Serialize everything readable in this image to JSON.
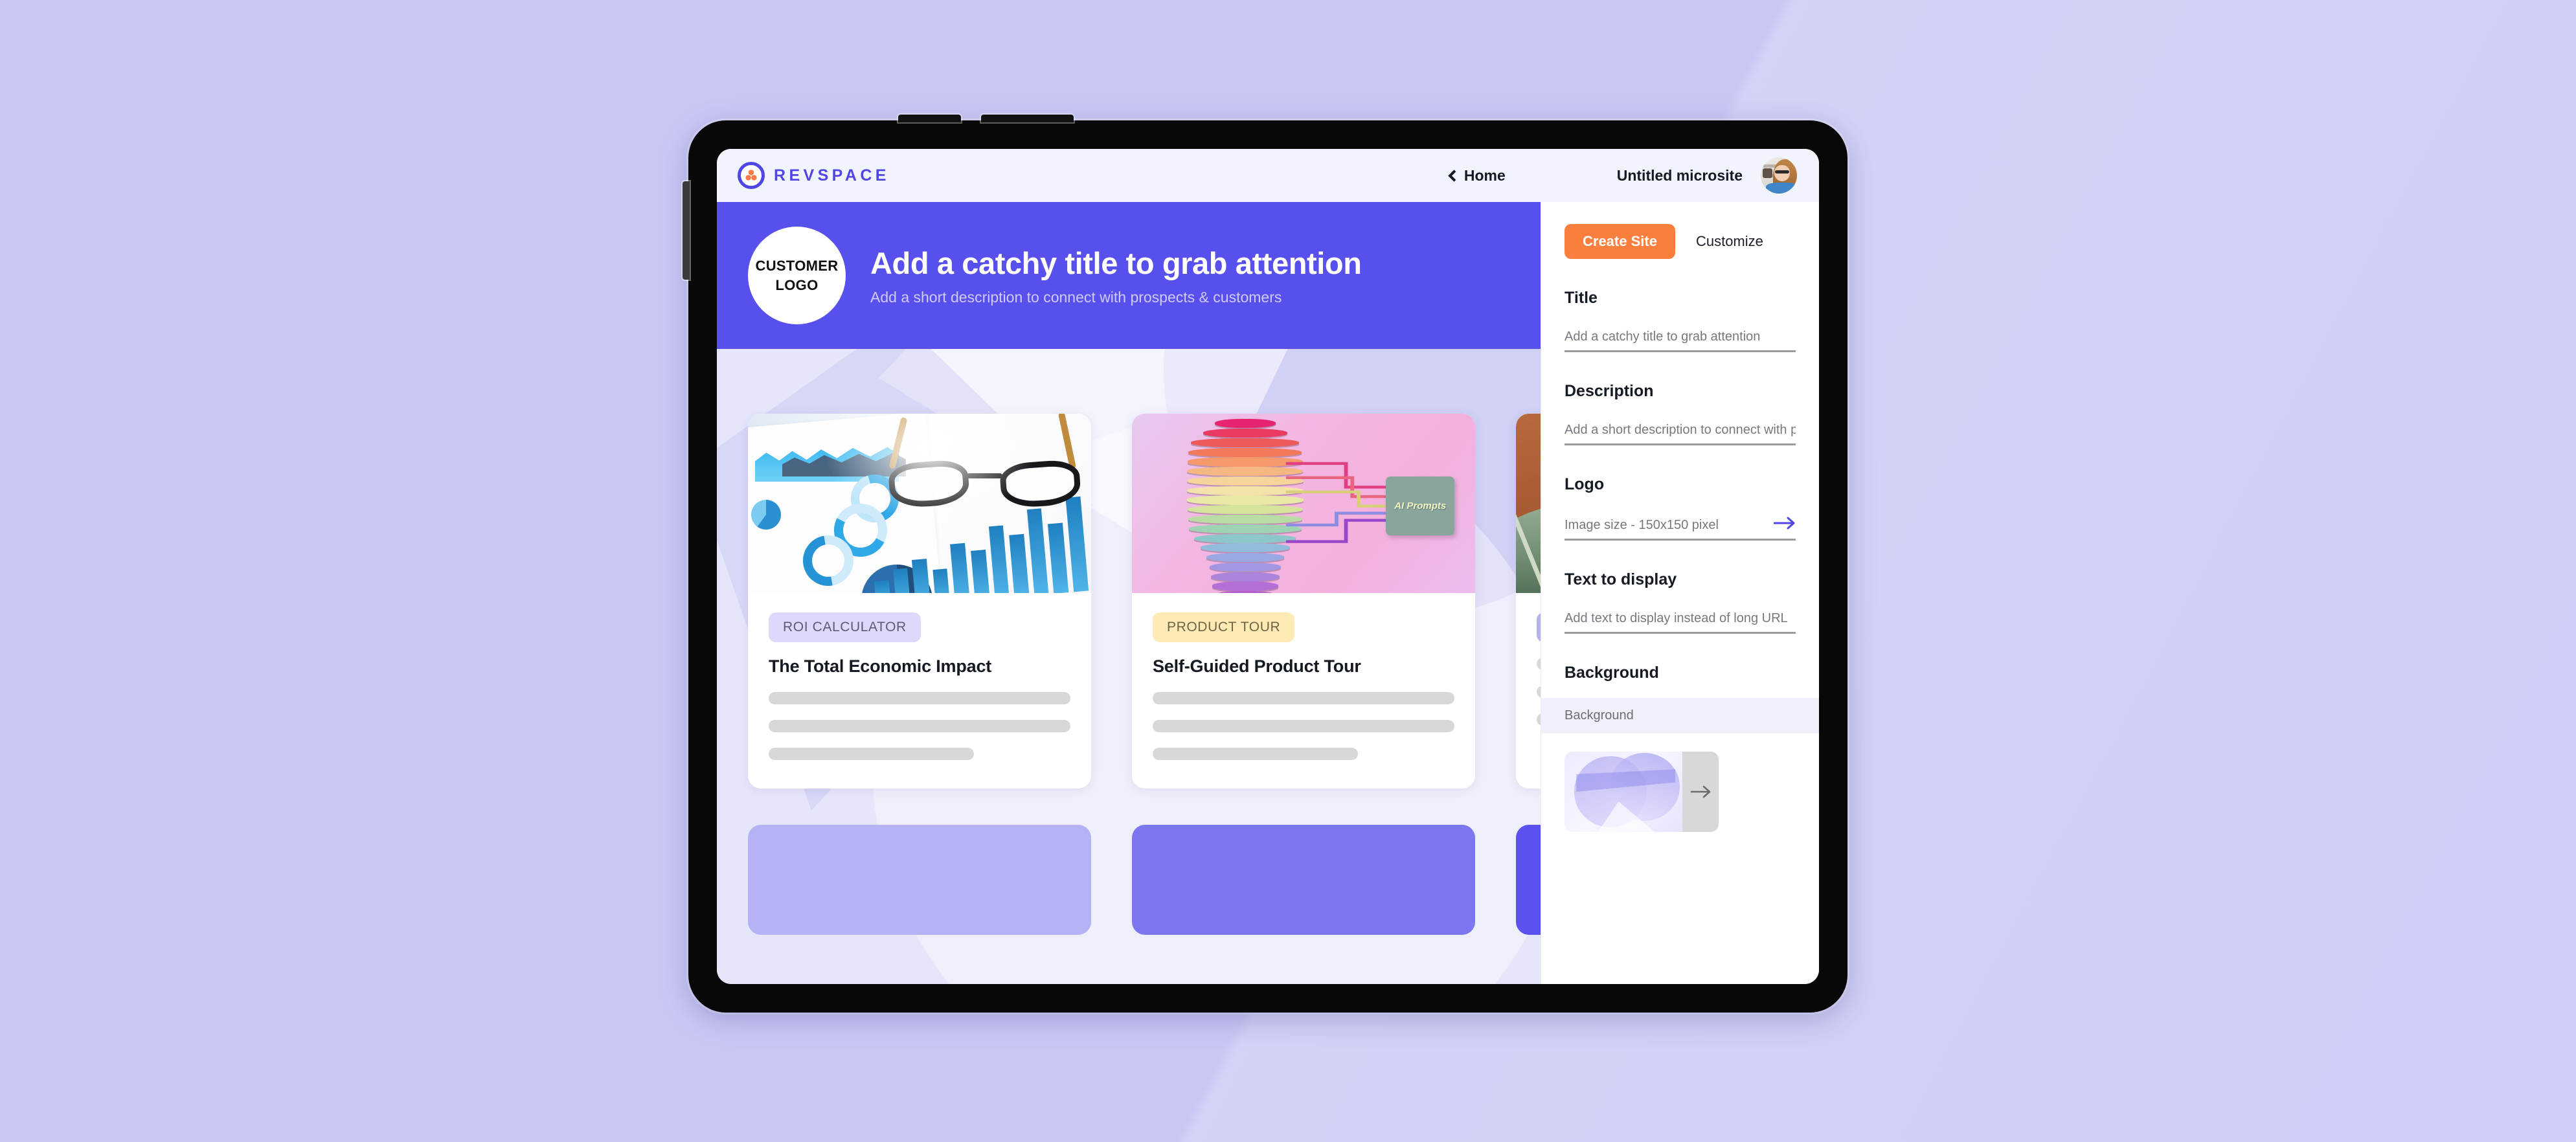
{
  "app": {
    "brand_name": "REVSPACE",
    "brand_icon": "revspace-logo-icon"
  },
  "topbar": {
    "home_label": "Home",
    "back_icon": "chevron-left-icon",
    "site_title": "Untitled microsite",
    "avatar_alt": "user-avatar"
  },
  "hero": {
    "logo_line1": "CUSTOMER",
    "logo_line2": "LOGO",
    "title": "Add a catchy title to grab attention",
    "subtitle": "Add a short description to connect with prospects & customers",
    "background_color": "#5850ec"
  },
  "cards": [
    {
      "badge": "ROI CALCULATOR",
      "badge_style": "badge-roi",
      "title": "The Total Economic Impact",
      "image": "charts-and-glasses-photo"
    },
    {
      "badge": "PRODUCT TOUR",
      "badge_style": "badge-tour",
      "title": "Self-Guided Product Tour",
      "image": "ai-prompts-head-illustration",
      "image_label": "AI Prompts"
    },
    {
      "badge": "",
      "badge_style": "badge-purple",
      "title": "",
      "image": "plant-and-bottle-photo"
    }
  ],
  "bottom_cards": [
    {
      "color": "#b5b2f6"
    },
    {
      "color": "#7d77ef"
    },
    {
      "color": "#5a51ee"
    }
  ],
  "sidebar": {
    "create_site_label": "Create Site",
    "customize_label": "Customize",
    "accent_color": "#f97f3f",
    "fields": [
      {
        "label": "Title",
        "placeholder": "Add a catchy title to grab attention",
        "value": ""
      },
      {
        "label": "Description",
        "placeholder": "Add a short description to connect with prc",
        "value": ""
      },
      {
        "label": "Logo",
        "placeholder": "Image size - 150x150 pixel",
        "value": "",
        "action_icon": "arrow-right-icon"
      },
      {
        "label": "Text to display",
        "placeholder": "Add text to display instead of long URL",
        "value": ""
      }
    ],
    "background": {
      "label": "Background",
      "select_value": "Background",
      "thumb_alt": "abstract-purple-shapes-thumbnail",
      "next_icon": "arrow-right-icon"
    }
  }
}
